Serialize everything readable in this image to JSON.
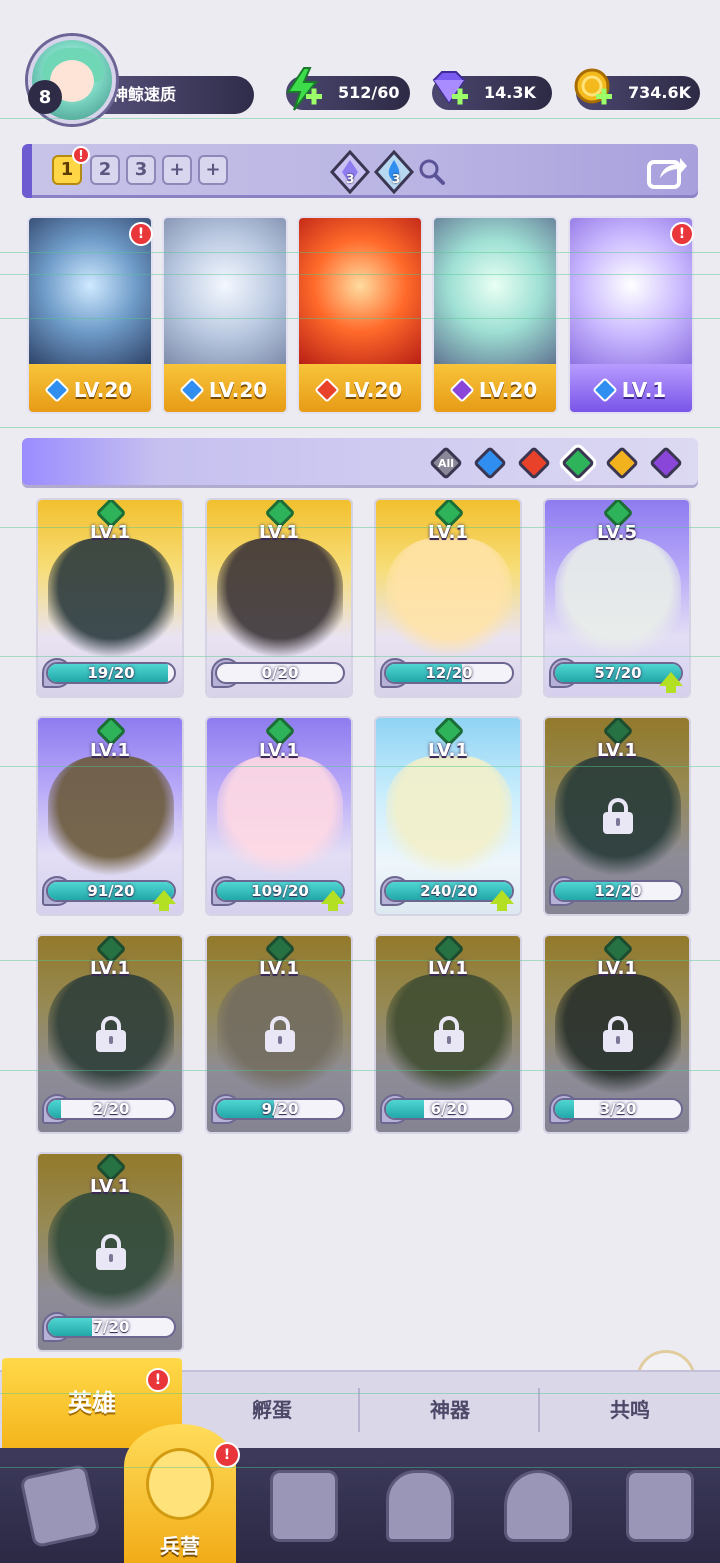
{
  "player": {
    "level": "8",
    "name": "神鲸速质"
  },
  "resources": [
    {
      "icon": "energy-icon",
      "value": "512/60",
      "color": "#3ddc4a"
    },
    {
      "icon": "gem-icon",
      "value": "14.3K",
      "color": "#7b5cf0"
    },
    {
      "icon": "coin-icon",
      "value": "734.6K",
      "color": "#f4b91c"
    }
  ],
  "team_slots": [
    "1",
    "2",
    "3",
    "+",
    "+"
  ],
  "team_counters": [
    "3",
    "3"
  ],
  "team_alert": "!",
  "lineup": [
    {
      "level": "LV.20",
      "element": "water",
      "alert": "!"
    },
    {
      "level": "LV.20",
      "element": "water",
      "alert": ""
    },
    {
      "level": "LV.20",
      "element": "fire",
      "alert": ""
    },
    {
      "level": "LV.20",
      "element": "dark",
      "alert": ""
    },
    {
      "level": "LV.1",
      "element": "water",
      "alert": "!"
    }
  ],
  "filters": [
    "All",
    "water",
    "fire",
    "nature",
    "light",
    "dark"
  ],
  "filter_all_label": "All",
  "heroes": [
    {
      "level": "LV.1",
      "progress": "19/20",
      "fill": 0.95,
      "rarity": "gold",
      "locked": false,
      "upgrade": false
    },
    {
      "level": "LV.1",
      "progress": "0/20",
      "fill": 0.0,
      "rarity": "gold",
      "locked": false,
      "upgrade": false
    },
    {
      "level": "LV.1",
      "progress": "12/20",
      "fill": 0.6,
      "rarity": "gold",
      "locked": false,
      "upgrade": false
    },
    {
      "level": "LV.5",
      "progress": "57/20",
      "fill": 1.0,
      "rarity": "purple",
      "locked": false,
      "upgrade": true
    },
    {
      "level": "LV.1",
      "progress": "91/20",
      "fill": 1.0,
      "rarity": "purple",
      "locked": false,
      "upgrade": true
    },
    {
      "level": "LV.1",
      "progress": "109/20",
      "fill": 1.0,
      "rarity": "purple",
      "locked": false,
      "upgrade": true
    },
    {
      "level": "LV.1",
      "progress": "240/20",
      "fill": 1.0,
      "rarity": "blue",
      "locked": false,
      "upgrade": true
    },
    {
      "level": "LV.1",
      "progress": "12/20",
      "fill": 0.6,
      "rarity": "gold",
      "locked": true,
      "upgrade": false
    },
    {
      "level": "LV.1",
      "progress": "2/20",
      "fill": 0.1,
      "rarity": "gold",
      "locked": true,
      "upgrade": false
    },
    {
      "level": "LV.1",
      "progress": "9/20",
      "fill": 0.45,
      "rarity": "gold",
      "locked": true,
      "upgrade": false
    },
    {
      "level": "LV.1",
      "progress": "6/20",
      "fill": 0.3,
      "rarity": "gold",
      "locked": true,
      "upgrade": false
    },
    {
      "level": "LV.1",
      "progress": "3/20",
      "fill": 0.15,
      "rarity": "gold",
      "locked": true,
      "upgrade": false
    },
    {
      "level": "LV.1",
      "progress": "7/20",
      "fill": 0.35,
      "rarity": "gold",
      "locked": true,
      "upgrade": false
    }
  ],
  "subtabs": [
    "英雄",
    "孵蛋",
    "神器",
    "共鸣"
  ],
  "subtab_alert": "!",
  "nav": {
    "items": [
      "cards-icon",
      "barracks-icon",
      "map-icon",
      "castle-icon",
      "mushroom-house-icon",
      "locked-tower-icon"
    ],
    "active_label": "兵营",
    "alert": "!"
  },
  "colors": {
    "water": "#2f8ef0",
    "fire": "#e8432a",
    "nature": "#2fb35a",
    "light": "#f1b21d",
    "dark": "#8a46d8",
    "gold": "#f2c02e",
    "purple": "#8e7cf0",
    "blue": "#8fd3f4"
  }
}
